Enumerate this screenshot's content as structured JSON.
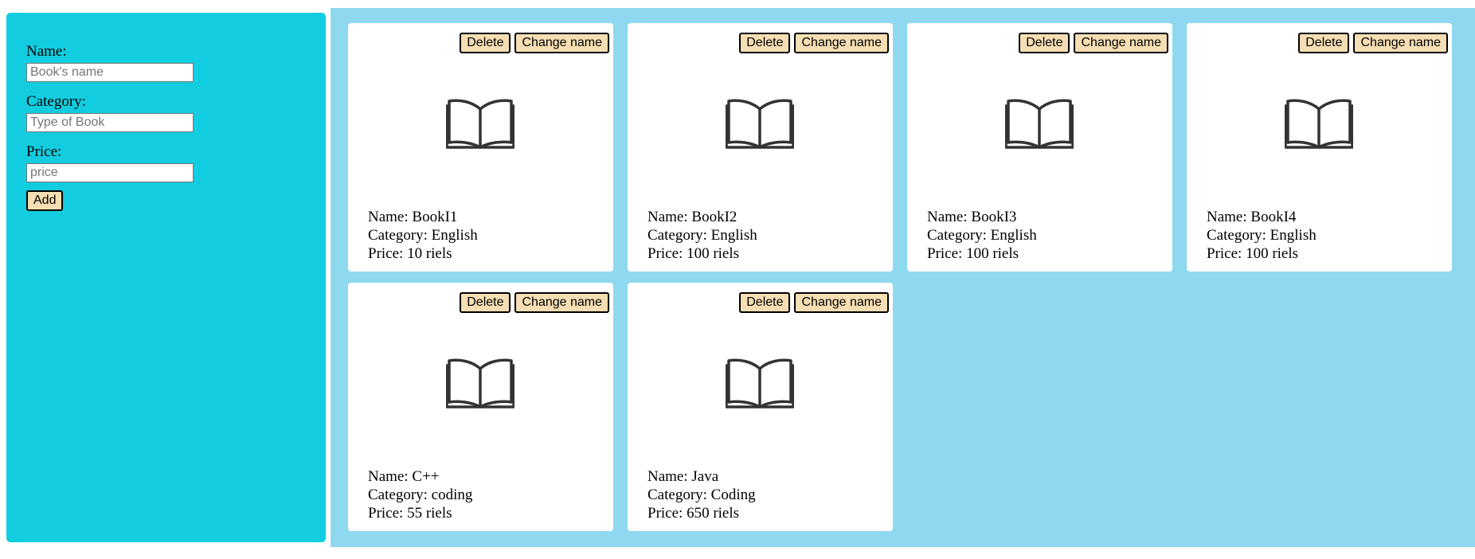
{
  "form": {
    "name_label": "Name:",
    "name_placeholder": "Book's name",
    "category_label": "Category:",
    "category_placeholder": "Type of Book",
    "price_label": "Price:",
    "price_placeholder": "price",
    "add_label": "Add"
  },
  "colors": {
    "sidebar_bg": "#12cde0",
    "main_bg": "#8fd9f0",
    "button_bg": "#f5deb3"
  },
  "books": [
    {
      "name_text": "Name: BookI1",
      "category_text": "Category: English",
      "price_text": "Price: 10 riels",
      "delete_label": "Delete",
      "rename_label": "Change name",
      "icon": "open-book-icon"
    },
    {
      "name_text": "Name: BookI2",
      "category_text": "Category: English",
      "price_text": "Price: 100 riels",
      "delete_label": "Delete",
      "rename_label": "Change name",
      "icon": "open-book-icon"
    },
    {
      "name_text": "Name: BookI3",
      "category_text": "Category: English",
      "price_text": "Price: 100 riels",
      "delete_label": "Delete",
      "rename_label": "Change name",
      "icon": "open-book-icon"
    },
    {
      "name_text": "Name: BookI4",
      "category_text": "Category: English",
      "price_text": "Price: 100 riels",
      "delete_label": "Delete",
      "rename_label": "Change name",
      "icon": "open-book-icon"
    },
    {
      "name_text": "Name: C++",
      "category_text": "Category: coding",
      "price_text": "Price: 55 riels",
      "delete_label": "Delete",
      "rename_label": "Change name",
      "icon": "open-book-icon"
    },
    {
      "name_text": "Name: Java",
      "category_text": "Category: Coding",
      "price_text": "Price: 650 riels",
      "delete_label": "Delete",
      "rename_label": "Change name",
      "icon": "open-book-icon"
    }
  ]
}
